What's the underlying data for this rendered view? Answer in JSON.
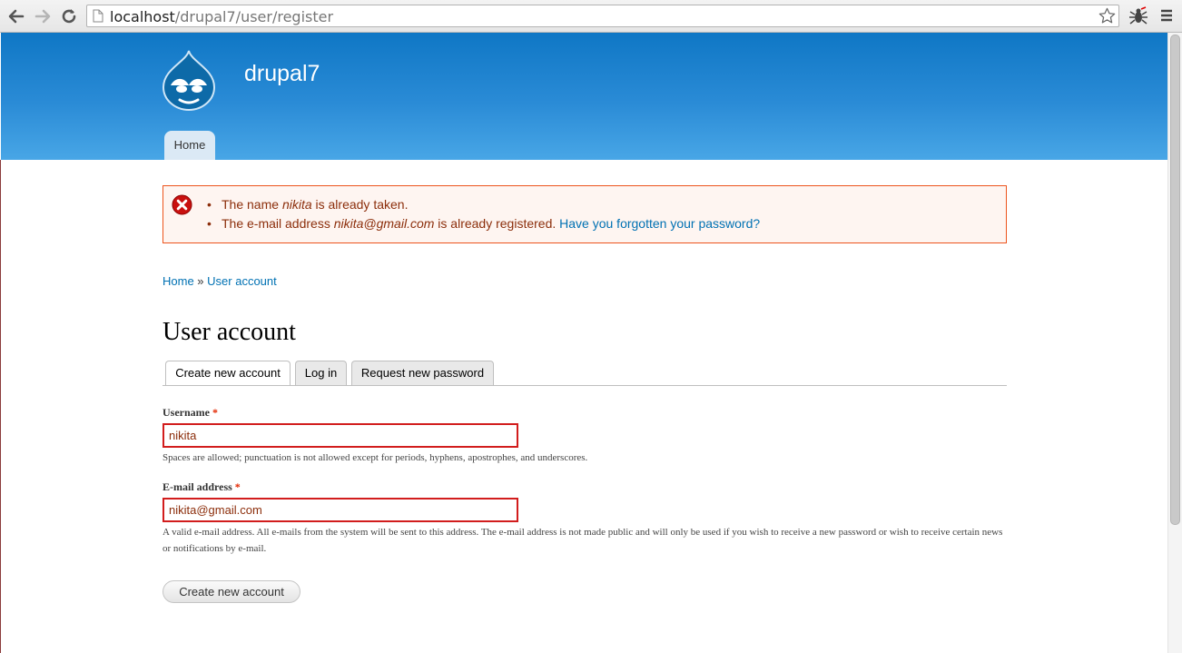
{
  "browser": {
    "url_host": "localhost",
    "url_path": "/drupal7/user/register"
  },
  "site": {
    "name": "drupal7",
    "nav": [
      {
        "label": "Home"
      }
    ]
  },
  "messages": {
    "name_error": {
      "prefix": "The name ",
      "value": "nikita",
      "suffix": " is already taken."
    },
    "email_error": {
      "prefix": "The e-mail address ",
      "value": "nikita@gmail.com",
      "suffix": " is already registered. ",
      "link": "Have you forgotten your password?"
    }
  },
  "breadcrumb": {
    "home": "Home",
    "separator": " » ",
    "current": "User account"
  },
  "page": {
    "title": "User account"
  },
  "tabs": [
    {
      "label": "Create new account",
      "active": true
    },
    {
      "label": "Log in",
      "active": false
    },
    {
      "label": "Request new password",
      "active": false
    }
  ],
  "form": {
    "username": {
      "label": "Username",
      "required_mark": "*",
      "value": "nikita",
      "description": "Spaces are allowed; punctuation is not allowed except for periods, hyphens, apostrophes, and underscores."
    },
    "email": {
      "label": "E-mail address",
      "required_mark": "*",
      "value": "nikita@gmail.com",
      "description": "A valid e-mail address. All e-mails from the system will be sent to this address. The e-mail address is not made public and will only be used if you wish to receive a new password or wish to receive certain news or notifications by e-mail."
    },
    "submit_label": "Create new account"
  },
  "colors": {
    "header_top": "#0f77c5",
    "header_bottom": "#48a6e6",
    "link": "#0071b3",
    "error_text": "#8c2e0b",
    "error_border": "#ed541d",
    "field_error_border": "#d21d1d"
  },
  "icons": [
    "back-icon",
    "forward-icon",
    "reload-icon",
    "page-icon",
    "star-icon",
    "extension-icon",
    "menu-icon",
    "drupal-logo-icon",
    "error-icon"
  ]
}
